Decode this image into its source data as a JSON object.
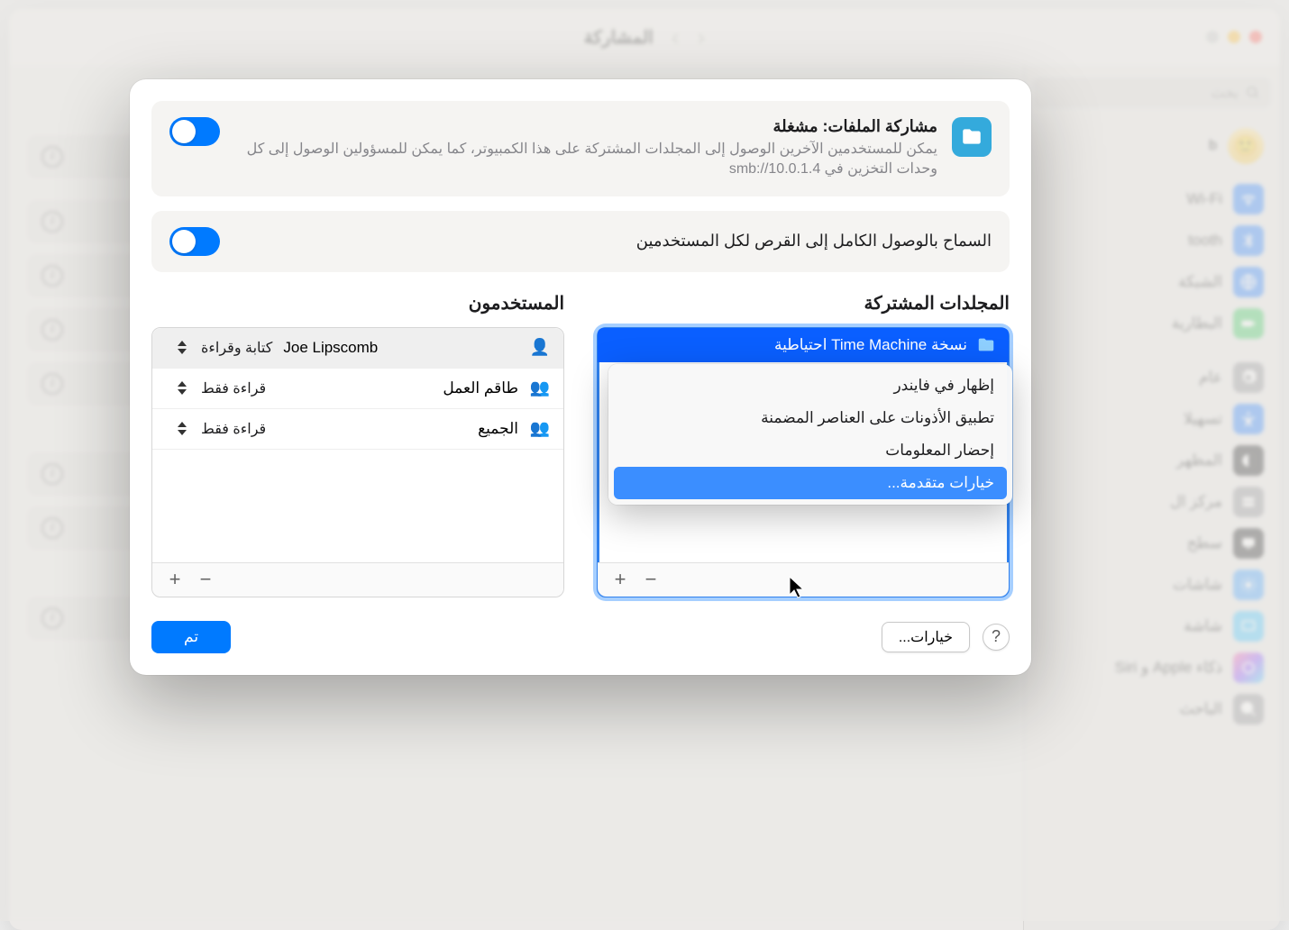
{
  "window": {
    "title": "المشاركة"
  },
  "search": {
    "placeholder": "بحث"
  },
  "sidebar": {
    "user_label": "b",
    "items": [
      {
        "label": "Wi-Fi",
        "color": "#1e7bff"
      },
      {
        "label": "tooth",
        "color": "#1e7bff"
      },
      {
        "label": "الشبكة",
        "color": "#1e7bff"
      },
      {
        "label": "البطارية",
        "color": "#34c759"
      }
    ],
    "items2": [
      {
        "label": "عام",
        "color": "#8e8e93"
      },
      {
        "label": "تسهيلا",
        "color": "#1e7bff"
      },
      {
        "label": "المظهر",
        "color": "#1d1d1f"
      },
      {
        "label": "مركز ال",
        "color": "#8e8e93"
      },
      {
        "label": "سطح",
        "color": "#1d1d1f"
      },
      {
        "label": "شاشات",
        "color": "#3a9cff"
      },
      {
        "label": "شاشة",
        "color": "#3ac1ff"
      },
      {
        "label": "ذكاء Apple و Siri",
        "color": "linear"
      },
      {
        "label": "الباحث",
        "color": "#8e8e93"
      }
    ]
  },
  "fileSharing": {
    "title": "مشاركة الملفات: مشغلة",
    "description": "يمكن للمستخدمين الآخرين الوصول إلى المجلدات المشتركة على هذا الكمبيوتر، كما يمكن للمسؤولين الوصول إلى كل وحدات التخزين في smb://10.0.1.4"
  },
  "fullDisk": {
    "label": "السماح بالوصول الكامل إلى القرص لكل المستخدمين"
  },
  "columns": {
    "folders": "المجلدات المشتركة",
    "users": "المستخدمون"
  },
  "folder": {
    "name": "نسخة Time Machine احتياطية"
  },
  "contextMenu": {
    "items": [
      "إظهار في فايندر",
      "تطبيق الأذونات على العناصر المضمنة",
      "إحضار المعلومات",
      "خيارات متقدمة..."
    ]
  },
  "users": [
    {
      "name": "Joe Lipscomb",
      "perm": "كتابة وقراءة",
      "icon": "single"
    },
    {
      "name": "طاقم العمل",
      "perm": "قراءة فقط",
      "icon": "group",
      "ar": true
    },
    {
      "name": "الجميع",
      "perm": "قراءة فقط",
      "icon": "group3",
      "ar": true
    }
  ],
  "footer": {
    "options": "خيارات...",
    "done": "تم"
  }
}
